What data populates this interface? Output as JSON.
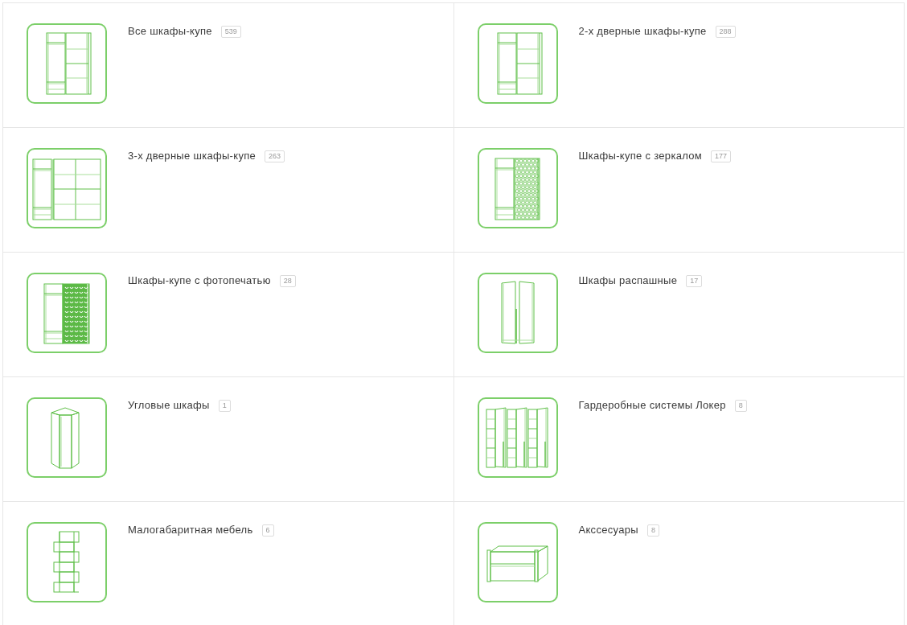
{
  "categories": [
    {
      "title": "Все шкафы-купе",
      "count": "539",
      "kind": "sliding2"
    },
    {
      "title": "2-х дверные шкафы-купе",
      "count": "288",
      "kind": "sliding2"
    },
    {
      "title": "3-х дверные шкафы-купе",
      "count": "263",
      "kind": "sliding3"
    },
    {
      "title": "Шкафы-купе с зеркалом",
      "count": "177",
      "kind": "mirror"
    },
    {
      "title": "Шкафы-купе с фотопечатью",
      "count": "28",
      "kind": "photo"
    },
    {
      "title": "Шкафы распашные",
      "count": "17",
      "kind": "swing"
    },
    {
      "title": "Угловые шкафы",
      "count": "1",
      "kind": "corner"
    },
    {
      "title": "Гардеробные системы Локер",
      "count": "8",
      "kind": "locker"
    },
    {
      "title": "Малогабаритная мебель",
      "count": "6",
      "kind": "compact"
    },
    {
      "title": "Акссесуары",
      "count": "8",
      "kind": "drawer"
    }
  ]
}
